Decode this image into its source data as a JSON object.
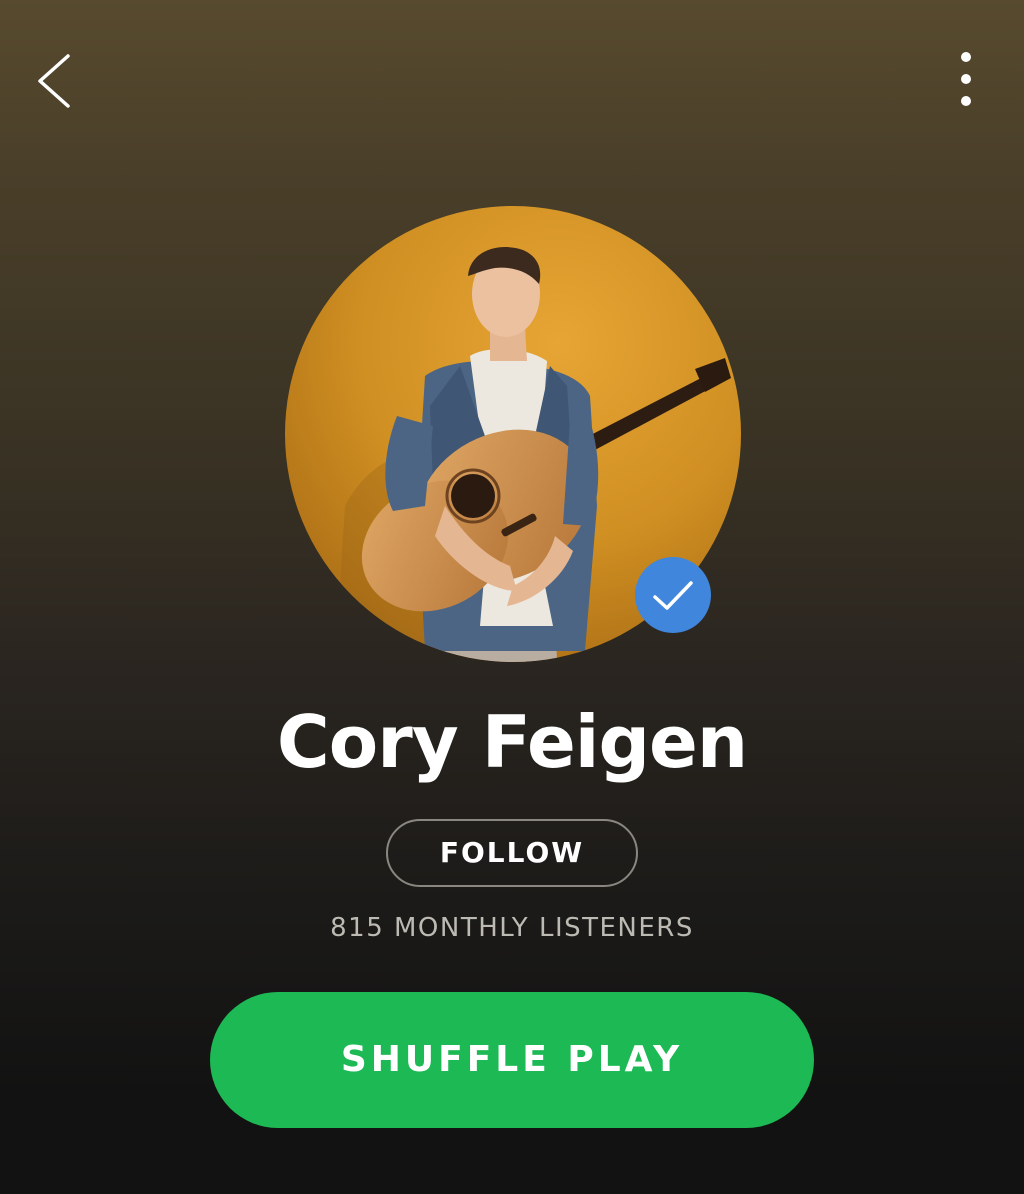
{
  "header": {
    "back_icon": "chevron-left-icon",
    "more_icon": "more-vertical-icon"
  },
  "artist": {
    "name": "Cory Feigen",
    "verified": true,
    "verified_icon": "checkmark-icon",
    "monthly_listeners": "815 MONTHLY LISTENERS"
  },
  "actions": {
    "follow_label": "FOLLOW",
    "shuffle_label": "SHUFFLE PLAY"
  },
  "colors": {
    "accent": "#1db954",
    "verified_badge": "#3f86dc",
    "background_top": "#574a2e",
    "background_bottom": "#121212"
  }
}
